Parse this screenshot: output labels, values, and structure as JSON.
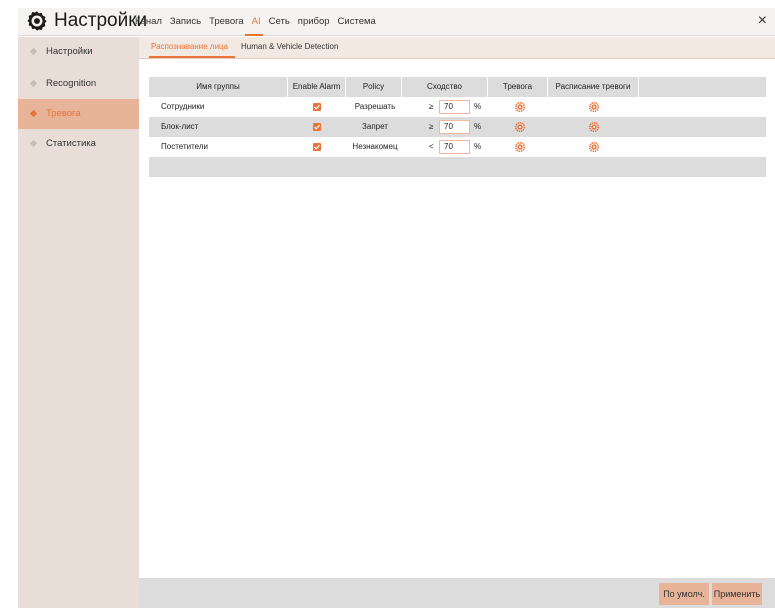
{
  "header": {
    "title": "Настройки",
    "nav": [
      {
        "label": "Канал",
        "active": false
      },
      {
        "label": "Запись",
        "active": false
      },
      {
        "label": "Тревога",
        "active": false
      },
      {
        "label": "AI",
        "active": true
      },
      {
        "label": "Сеть",
        "active": false
      },
      {
        "label": "прибор",
        "active": false
      },
      {
        "label": "Система",
        "active": false
      }
    ],
    "close_label": "×"
  },
  "sidebar": {
    "items": [
      {
        "label": "Настройки",
        "active": false
      },
      {
        "label": "Recognition",
        "active": false
      },
      {
        "label": "Тревога",
        "active": true
      },
      {
        "label": "Статистика",
        "active": false
      }
    ]
  },
  "subtabs": [
    {
      "label": "Распознавание лица",
      "active": true
    },
    {
      "label": "Human & Vehicle Detection",
      "active": false
    }
  ],
  "table": {
    "columns": [
      "Имя группы",
      "Enable Alarm",
      "Policy",
      "Сходство",
      "Тревога",
      "Расписание тревоги"
    ],
    "rows": [
      {
        "name": "Сотрудники",
        "enabled": true,
        "policy": "Разрешать",
        "operator": "≥",
        "similarity": "70",
        "unit": "%"
      },
      {
        "name": "Блок-лист",
        "enabled": true,
        "policy": "Запрет",
        "operator": "≥",
        "similarity": "70",
        "unit": "%"
      },
      {
        "name": "Постетители",
        "enabled": true,
        "policy": "Незнакомец",
        "operator": "<",
        "similarity": "70",
        "unit": "%"
      }
    ]
  },
  "footer": {
    "default_label": "По умолч.",
    "apply_label": "Применить"
  },
  "colors": {
    "accent": "#e8743a",
    "sidebar_bg": "#e8ddd7",
    "sidebar_active": "#e8b499",
    "row_alt": "#dcdcdc"
  }
}
